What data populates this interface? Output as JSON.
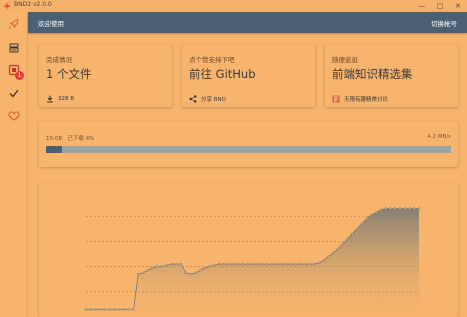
{
  "window": {
    "title": "BND2 v2.0.0",
    "minimize": "—",
    "maximize": "□",
    "close": "✕"
  },
  "sidebar": {
    "items": [
      {
        "icon": "rocket-icon"
      },
      {
        "icon": "database-icon"
      },
      {
        "icon": "download-list-icon",
        "badge": "1"
      },
      {
        "icon": "checkmark-icon"
      },
      {
        "icon": "heart-icon"
      }
    ]
  },
  "topbar": {
    "welcome": "欢迎使用",
    "switch_account": "切换帐号"
  },
  "cards": [
    {
      "label": "完成情况",
      "value": "1 个文件",
      "footer": "328 B",
      "footer_icon": "download-icon"
    },
    {
      "label": "点个赞支持下吧",
      "value": "前往 GitHub",
      "footer": "分享 BND",
      "footer_icon": "share-icon"
    },
    {
      "label": "随便逛逛",
      "value": "前端知识精选集",
      "footer": "无限有趣精美讨论",
      "footer_icon": "book-icon"
    }
  ],
  "progress": {
    "left_text": "15:08　已下载 4%",
    "right_text": "4.2 MB/s",
    "percent": 4
  },
  "colors": {
    "background": "#f7b46c",
    "topbar": "#4a6174",
    "progress_fill": "#4a6174",
    "progress_track": "#9aa4a8",
    "badge": "#e53935"
  },
  "chart_data": {
    "type": "area",
    "title": "",
    "xlabel": "",
    "ylabel": "",
    "grid": true,
    "x": [
      0,
      1,
      2,
      3,
      4,
      5,
      6,
      7,
      8,
      9,
      10,
      11,
      12,
      13,
      14,
      15,
      16,
      17,
      18,
      19,
      20,
      21,
      22,
      23,
      24,
      25,
      26,
      27,
      28,
      29,
      30,
      31,
      32,
      33,
      34,
      35,
      36,
      37,
      38,
      39,
      40,
      41,
      42,
      43,
      44,
      45,
      46,
      47,
      48,
      49,
      50,
      51,
      52,
      53,
      54,
      55,
      56,
      57,
      58,
      59,
      60,
      61,
      62,
      63,
      64,
      65,
      66,
      67,
      68,
      69,
      70
    ],
    "values": [
      0.3,
      0.3,
      0.3,
      0.3,
      0.3,
      0.3,
      0.3,
      0.3,
      0.3,
      0.3,
      0.3,
      1.7,
      1.75,
      1.85,
      1.95,
      2.0,
      2.0,
      2.05,
      2.1,
      2.1,
      2.1,
      1.75,
      1.7,
      1.75,
      1.85,
      1.95,
      2.0,
      2.05,
      2.1,
      2.1,
      2.1,
      2.1,
      2.1,
      2.1,
      2.1,
      2.1,
      2.1,
      2.1,
      2.1,
      2.1,
      2.1,
      2.1,
      2.1,
      2.1,
      2.1,
      2.1,
      2.1,
      2.1,
      2.1,
      2.15,
      2.25,
      2.4,
      2.55,
      2.7,
      2.9,
      3.1,
      3.3,
      3.5,
      3.7,
      3.9,
      4.05,
      4.15,
      4.25,
      4.3,
      4.3,
      4.3,
      4.3,
      4.3,
      4.3,
      4.3,
      4.3
    ],
    "ylim": [
      0,
      5
    ]
  }
}
